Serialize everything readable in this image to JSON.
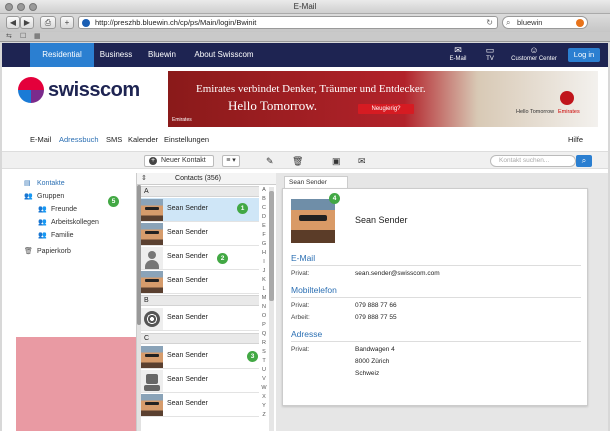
{
  "window": {
    "title": "E-Mail"
  },
  "browser": {
    "url": "http://preszhb.bluewin.ch/cp/ps/Main/login/Bwinit",
    "search_value": "bluewin",
    "back": "◀",
    "forward": "▶",
    "add_tab": "+"
  },
  "topnav": {
    "items": [
      "Residential",
      "Business",
      "Bluewin",
      "About Swisscom"
    ],
    "icons": [
      {
        "icon": "mail-icon",
        "label": "E-Mail"
      },
      {
        "icon": "tv-icon",
        "label": "TV"
      },
      {
        "icon": "customer-center-icon",
        "label": "Customer Center"
      }
    ],
    "login": "Log in"
  },
  "header": {
    "logo_text": "swisscom",
    "banner": {
      "line1": "Emirates verbindet Denker, Träumer und Entdecker.",
      "line2": "Hello Tomorrow.",
      "cta": "Neugierig?",
      "small": "Emirates",
      "right1": "Hello Tomorrow",
      "right2": "Emirates"
    }
  },
  "app_menu": {
    "items": [
      "E-Mail",
      "Adressbuch",
      "SMS",
      "Kalender",
      "Einstellungen"
    ],
    "selected_index": 1,
    "help": "Hilfe"
  },
  "actionbar": {
    "new_contact": "Neuer Kontakt",
    "search_placeholder": "Kontakt suchen..."
  },
  "sidebar": {
    "items": [
      {
        "label": "Kontakte",
        "icon": "contacts-icon",
        "active": true
      },
      {
        "label": "Gruppen",
        "icon": "groups-icon"
      },
      {
        "label": "Freunde",
        "icon": "group-icon"
      },
      {
        "label": "Arbeitskollegen",
        "icon": "group-icon"
      },
      {
        "label": "Familie",
        "icon": "group-icon"
      },
      {
        "label": "Papierkorb",
        "icon": "trash-icon"
      }
    ]
  },
  "contacts": {
    "header": "Contacts (356)",
    "sections": [
      {
        "letter": "A",
        "rows": [
          {
            "name": "Sean Sender",
            "avatar": "photo",
            "selected": true
          },
          {
            "name": "Sean Sender",
            "avatar": "photo"
          },
          {
            "name": "Sean Sender",
            "avatar": "placeholder"
          },
          {
            "name": "Sean Sender",
            "avatar": "photo"
          }
        ]
      },
      {
        "letter": "B",
        "rows": [
          {
            "name": "Sean Sender",
            "avatar": "reel"
          }
        ]
      },
      {
        "letter": "C",
        "rows": [
          {
            "name": "Sean Sender",
            "avatar": "photo"
          },
          {
            "name": "Sean Sender",
            "avatar": "robot"
          },
          {
            "name": "Sean Sender",
            "avatar": "photo"
          }
        ]
      }
    ],
    "alphabet": [
      "A",
      "B",
      "C",
      "D",
      "E",
      "F",
      "G",
      "H",
      "I",
      "J",
      "K",
      "L",
      "M",
      "N",
      "O",
      "P",
      "Q",
      "R",
      "S",
      "T",
      "U",
      "V",
      "W",
      "X",
      "Y",
      "Z"
    ]
  },
  "detail": {
    "tab": "Sean Sender",
    "name": "Sean Sender",
    "email_title": "E-Mail",
    "email_label": "Privat:",
    "email_value": "sean.sender@swisscom.com",
    "phone_title": "Mobiltelefon",
    "phone_private_label": "Privat:",
    "phone_private_value": "079 888 77 66",
    "phone_work_label": "Arbeit:",
    "phone_work_value": "079 888 77 55",
    "address_title": "Adresse",
    "address_label": "Privat:",
    "address_lines": [
      "Bandwagen 4",
      "8000 Zürich",
      "Schweiz"
    ]
  },
  "callouts": [
    "1",
    "2",
    "3",
    "4",
    "5"
  ],
  "colors": {
    "nav": "#1e2452",
    "accent": "#2b7fd1",
    "callout": "#42a844"
  }
}
